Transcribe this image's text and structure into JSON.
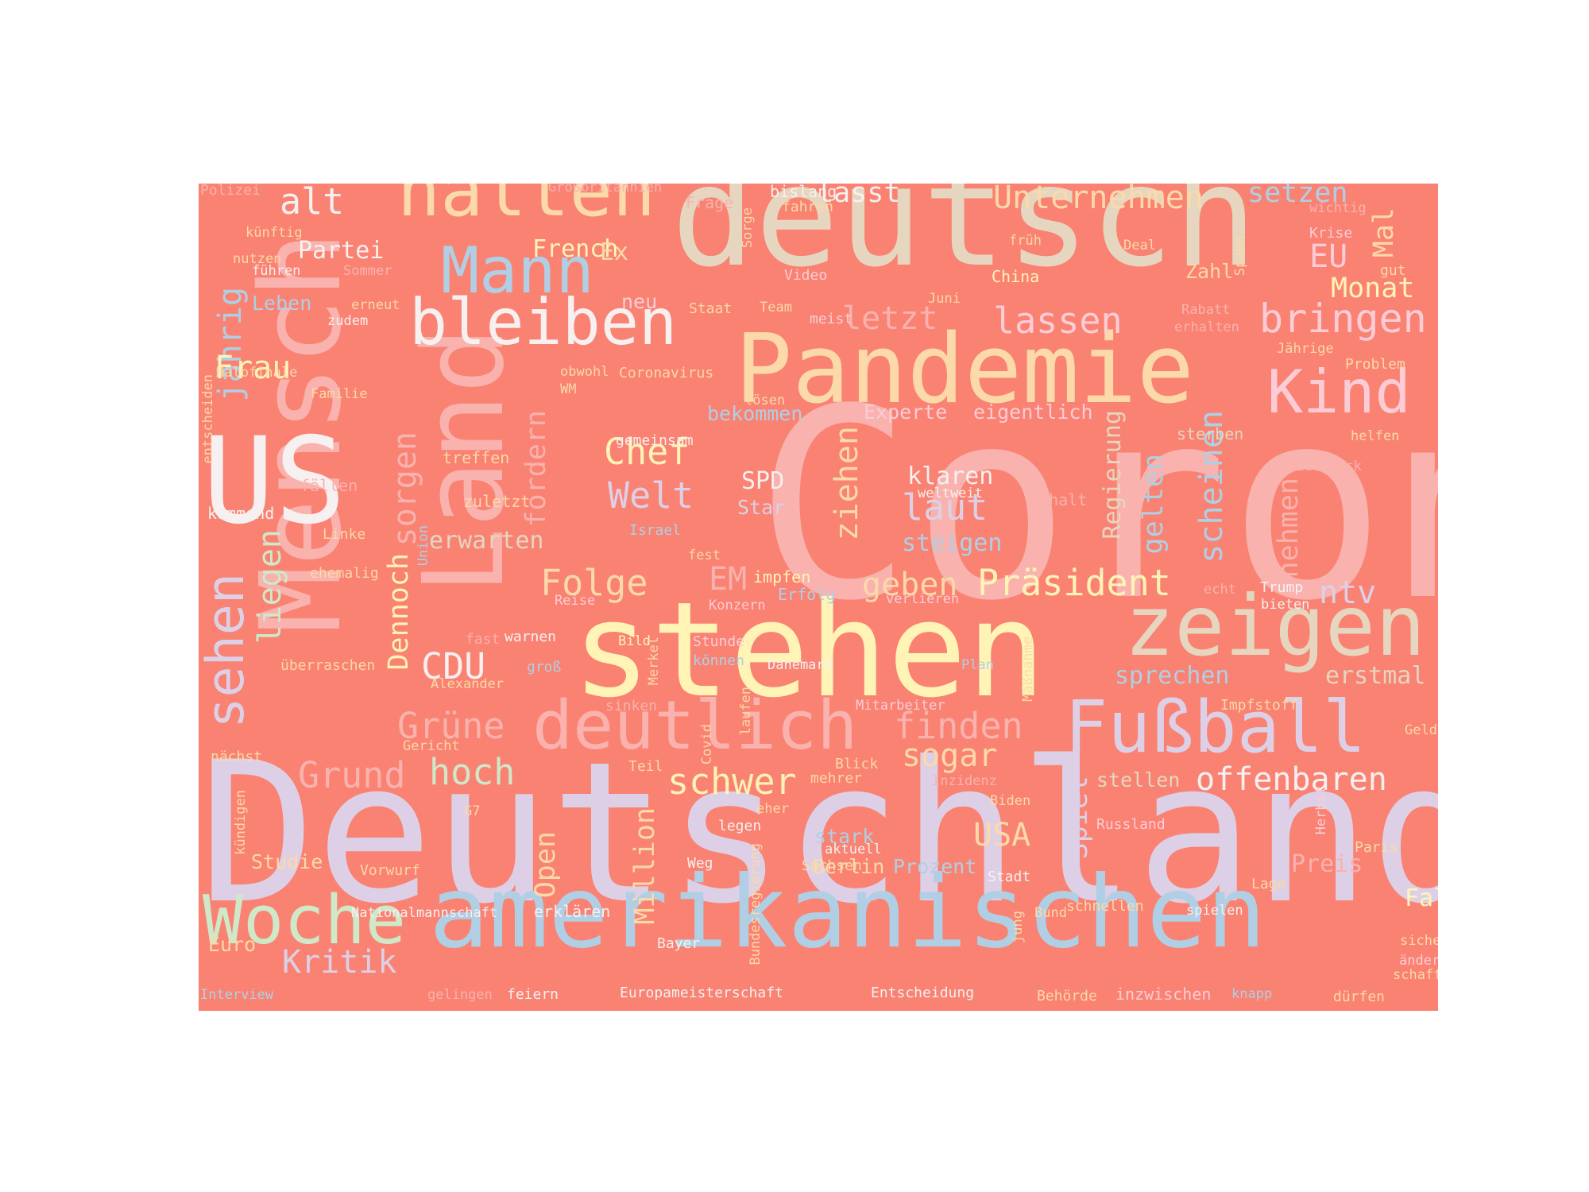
{
  "canvas": {
    "background": "#f98272"
  },
  "palette": {
    "lavender": "#ddd0e6",
    "pink": "#f9b2ae",
    "sand": "#e6d6c0",
    "yellow": "#fff4b6",
    "blue": "#b0cfe4",
    "peach": "#fcd9a8",
    "mint": "#cfe8c8",
    "white": "#f6f0f0",
    "rose": "#fcccd6"
  },
  "words": [
    {
      "text": "Corona",
      "color": "#f9b2ae"
    },
    {
      "text": "Deutschland",
      "color": "#ddd0e6"
    },
    {
      "text": "deutsch",
      "color": "#e6d6c0"
    },
    {
      "text": "stehen",
      "color": "#fff4b6"
    },
    {
      "text": "amerikanischen",
      "color": "#b0cfe4"
    },
    {
      "text": "Mensch",
      "color": "#f9b2ae"
    },
    {
      "text": "Land",
      "color": "#f9b2ae"
    },
    {
      "text": "Pandemie",
      "color": "#fcd9a8"
    },
    {
      "text": "US",
      "color": "#f6f0f0"
    },
    {
      "text": "zeigen",
      "color": "#e6d6c0"
    },
    {
      "text": "Fußball",
      "color": "#ddd0e6"
    },
    {
      "text": "deutlich",
      "color": "#f9b2ae"
    },
    {
      "text": "halten",
      "color": "#fcd9a8"
    },
    {
      "text": "bleiben",
      "color": "#f6f0f0"
    },
    {
      "text": "Mann",
      "color": "#b0cfe4"
    },
    {
      "text": "Woche",
      "color": "#cfe8c8"
    },
    {
      "text": "Kind",
      "color": "#fcccd6"
    },
    {
      "text": "sehen",
      "color": "#ddd0e6"
    },
    {
      "text": "bringen",
      "color": "#fcccd6"
    },
    {
      "text": "lassen",
      "color": "#fcccd6"
    },
    {
      "text": "Unternehmen",
      "color": "#fcd9a8"
    },
    {
      "text": "Präsident",
      "color": "#fff4b6"
    },
    {
      "text": "Folge",
      "color": "#fcd9a8"
    },
    {
      "text": "Grüne",
      "color": "#f9b2ae"
    },
    {
      "text": "finden",
      "color": "#f9b2ae"
    },
    {
      "text": "Welt",
      "color": "#ddd0e6"
    },
    {
      "text": "Chef",
      "color": "#fff4b6"
    },
    {
      "text": "CDU",
      "color": "#f6f0f0"
    },
    {
      "text": "Grund",
      "color": "#f9b2ae"
    },
    {
      "text": "hoch",
      "color": "#cfe8c8"
    },
    {
      "text": "schwer",
      "color": "#fff4b6"
    },
    {
      "text": "offenbaren",
      "color": "#f6f0f0"
    },
    {
      "text": "laut",
      "color": "#ddd0e6"
    },
    {
      "text": "Kritik",
      "color": "#ddd0e6"
    },
    {
      "text": "jährig",
      "color": "#b0cfe4"
    },
    {
      "text": "liegen",
      "color": "#cfe8c8"
    },
    {
      "text": "Dennoch",
      "color": "#fff4b6"
    },
    {
      "text": "sorgen",
      "color": "#f9b2ae"
    },
    {
      "text": "fordern",
      "color": "#f9b2ae"
    },
    {
      "text": "ziehen",
      "color": "#fcd9a8"
    },
    {
      "text": "gelten",
      "color": "#b0cfe4"
    },
    {
      "text": "scheinen",
      "color": "#b0cfe4"
    },
    {
      "text": "nehmen",
      "color": "#f9b2ae"
    },
    {
      "text": "ntv",
      "color": "#ddd0e6"
    },
    {
      "text": "geben",
      "color": "#fcd9a8"
    },
    {
      "text": "sogar",
      "color": "#fcd9a8"
    },
    {
      "text": "setzen",
      "color": "#b0cfe4"
    },
    {
      "text": "lässt",
      "color": "#f6f0f0"
    },
    {
      "text": "alt",
      "color": "#f6f0f0"
    },
    {
      "text": "Frau",
      "color": "#fff4b6"
    },
    {
      "text": "letzt",
      "color": "#f9b2ae"
    },
    {
      "text": "EU",
      "color": "#fcccd6"
    },
    {
      "text": "Mal",
      "color": "#fcd9a8"
    },
    {
      "text": "Monat",
      "color": "#fff4b6"
    },
    {
      "text": "Spiel",
      "color": "#ddd0e6"
    },
    {
      "text": "USA",
      "color": "#fcd9a8"
    },
    {
      "text": "Million",
      "color": "#fcd9a8"
    },
    {
      "text": "Open",
      "color": "#fcd9a8"
    },
    {
      "text": "EM",
      "color": "#f9b2ae"
    },
    {
      "text": "sprechen",
      "color": "#b0cfe4"
    },
    {
      "text": "erstmal",
      "color": "#e6d6c0"
    },
    {
      "text": "Regierung",
      "color": "#e6d6c0"
    },
    {
      "text": "erwarten",
      "color": "#e6d6c0"
    },
    {
      "text": "klaren",
      "color": "#f6f0f0"
    },
    {
      "text": "steigen",
      "color": "#b0cfe4"
    },
    {
      "text": "SPD",
      "color": "#f6f0f0"
    },
    {
      "text": "Star",
      "color": "#ddd0e6"
    },
    {
      "text": "Partei",
      "color": "#f6f0f0"
    },
    {
      "text": "French",
      "color": "#fff4b6"
    },
    {
      "text": "Ex",
      "color": "#fcd9a8"
    },
    {
      "text": "bekommen",
      "color": "#b0cfe4"
    },
    {
      "text": "Experte",
      "color": "#fcccd6"
    },
    {
      "text": "eigentlich",
      "color": "#fcccd6"
    },
    {
      "text": "stellen",
      "color": "#e6d6c0"
    },
    {
      "text": "stark",
      "color": "#b0cfe4"
    },
    {
      "text": "Euro",
      "color": "#fcd9a8"
    },
    {
      "text": "Fall",
      "color": "#fff4b6"
    },
    {
      "text": "Preis",
      "color": "#f9b2ae"
    },
    {
      "text": "Prozent",
      "color": "#b0cfe4"
    },
    {
      "text": "Berlin",
      "color": "#fcd9a8"
    },
    {
      "text": "Studie",
      "color": "#fcd9a8"
    },
    {
      "text": "Leben",
      "color": "#b0cfe4"
    },
    {
      "text": "Zahl",
      "color": "#fcd9a8"
    },
    {
      "text": "neu",
      "color": "#fcccd6"
    },
    {
      "text": "Großbritannien",
      "color": "#f9b2ae"
    },
    {
      "text": "Frage",
      "color": "#f9b2ae"
    },
    {
      "text": "bislang",
      "color": "#f6f0f0"
    },
    {
      "text": "fahren",
      "color": "#fcd9a8"
    },
    {
      "text": "wichtig",
      "color": "#f9b2ae"
    },
    {
      "text": "Polizei",
      "color": "#f9b2ae"
    },
    {
      "text": "künftig",
      "color": "#fcd9a8"
    },
    {
      "text": "nutzen",
      "color": "#fcd9a8"
    },
    {
      "text": "führen",
      "color": "#f6f0f0"
    },
    {
      "text": "Sommer",
      "color": "#f9b2ae"
    },
    {
      "text": "Sorge",
      "color": "#fcd9a8"
    },
    {
      "text": "früh",
      "color": "#fcd9a8"
    },
    {
      "text": "Deal",
      "color": "#fcd9a8"
    },
    {
      "text": "Krise",
      "color": "#fcccd6"
    },
    {
      "text": "Spahn",
      "color": "#fcd9a8"
    },
    {
      "text": "gut",
      "color": "#fcd9a8"
    },
    {
      "text": "Video",
      "color": "#fcccd6"
    },
    {
      "text": "China",
      "color": "#fff4b6"
    },
    {
      "text": "Juni",
      "color": "#fcd9a8"
    },
    {
      "text": "Staat",
      "color": "#fcd9a8"
    },
    {
      "text": "Team",
      "color": "#fcd9a8"
    },
    {
      "text": "meist",
      "color": "#fcccd6"
    },
    {
      "text": "Rabatt",
      "color": "#f9b2ae"
    },
    {
      "text": "erhalten",
      "color": "#f9b2ae"
    },
    {
      "text": "erneut",
      "color": "#fcd9a8"
    },
    {
      "text": "zudem",
      "color": "#f6f0f0"
    },
    {
      "text": "Jährige",
      "color": "#fcd9a8"
    },
    {
      "text": "Problem",
      "color": "#fcd9a8"
    },
    {
      "text": "Halbfinale",
      "color": "#fcd9a8"
    },
    {
      "text": "Familie",
      "color": "#fcd9a8"
    },
    {
      "text": "obwohl",
      "color": "#fcd9a8"
    },
    {
      "text": "WM",
      "color": "#fcd9a8"
    },
    {
      "text": "Coronavirus",
      "color": "#fcd9a8"
    },
    {
      "text": "lösen",
      "color": "#fcd9a8"
    },
    {
      "text": "sterben",
      "color": "#e6d6c0"
    },
    {
      "text": "helfen",
      "color": "#fcd9a8"
    },
    {
      "text": "entscheiden",
      "color": "#fcd9a8"
    },
    {
      "text": "gemeinsam",
      "color": "#f6f0f0"
    },
    {
      "text": "treffen",
      "color": "#fcd9a8"
    },
    {
      "text": "fällen",
      "color": "#f9b2ae"
    },
    {
      "text": "zuletzt",
      "color": "#fcd9a8"
    },
    {
      "text": "weltweit",
      "color": "#f6f0f0"
    },
    {
      "text": "Anhalt",
      "color": "#f9b2ae"
    },
    {
      "text": "Baerbock",
      "color": "#f9b2ae"
    },
    {
      "text": "kommend",
      "color": "#f6f0f0"
    },
    {
      "text": "Linke",
      "color": "#fcd9a8"
    },
    {
      "text": "Israel",
      "color": "#b0cfe4"
    },
    {
      "text": "Union",
      "color": "#b0cfe4"
    },
    {
      "text": "fest",
      "color": "#fcd9a8"
    },
    {
      "text": "impfen",
      "color": "#fff4b6"
    },
    {
      "text": "ehemalig",
      "color": "#fcd9a8"
    },
    {
      "text": "Reise",
      "color": "#fcccd6"
    },
    {
      "text": "Erfolg",
      "color": "#b0cfe4"
    },
    {
      "text": "Konzern",
      "color": "#fcccd6"
    },
    {
      "text": "verlieren",
      "color": "#fcccd6"
    },
    {
      "text": "echt",
      "color": "#f9b2ae"
    },
    {
      "text": "Trump",
      "color": "#f6f0f0"
    },
    {
      "text": "bieten",
      "color": "#f6f0f0"
    },
    {
      "text": "fast",
      "color": "#f9b2ae"
    },
    {
      "text": "warnen",
      "color": "#f6f0f0"
    },
    {
      "text": "Bild",
      "color": "#fff4b6"
    },
    {
      "text": "Stunde",
      "color": "#fcccd6"
    },
    {
      "text": "können",
      "color": "#b0cfe4"
    },
    {
      "text": "Dänemark",
      "color": "#f6f0f0"
    },
    {
      "text": "Maßnahme",
      "color": "#fcd9a8"
    },
    {
      "text": "Plan",
      "color": "#b0cfe4"
    },
    {
      "text": "überraschen",
      "color": "#fcd9a8"
    },
    {
      "text": "Alexander",
      "color": "#fcd9a8"
    },
    {
      "text": "groß",
      "color": "#b0cfe4"
    },
    {
      "text": "Merkel",
      "color": "#fcd9a8"
    },
    {
      "text": "sinken",
      "color": "#f9b2ae"
    },
    {
      "text": "Covid",
      "color": "#fcd9a8"
    },
    {
      "text": "laufen",
      "color": "#fcd9a8"
    },
    {
      "text": "Mitarbeiter",
      "color": "#fcccd6"
    },
    {
      "text": "Impfstoff",
      "color": "#fcd9a8"
    },
    {
      "text": "Geld",
      "color": "#fcd9a8"
    },
    {
      "text": "Gericht",
      "color": "#fcd9a8"
    },
    {
      "text": "nächst",
      "color": "#fcd9a8"
    },
    {
      "text": "Teil",
      "color": "#fcd9a8"
    },
    {
      "text": "Blick",
      "color": "#fcd9a8"
    },
    {
      "text": "mehrer",
      "color": "#fcd9a8"
    },
    {
      "text": "Inzidenz",
      "color": "#f9b2ae"
    },
    {
      "text": "Biden",
      "color": "#fcd9a8"
    },
    {
      "text": "G7",
      "color": "#fcd9a8"
    },
    {
      "text": "eher",
      "color": "#fcd9a8"
    },
    {
      "text": "legen",
      "color": "#f6f0f0"
    },
    {
      "text": "Russland",
      "color": "#fcccd6"
    },
    {
      "text": "Herbst",
      "color": "#fcccd6"
    },
    {
      "text": "Paris",
      "color": "#fcd9a8"
    },
    {
      "text": "kündigen",
      "color": "#fcd9a8"
    },
    {
      "text": "Weg",
      "color": "#f6f0f0"
    },
    {
      "text": "aktuell",
      "color": "#f6f0f0"
    },
    {
      "text": "Sachsen",
      "color": "#fcd9a8"
    },
    {
      "text": "Stadt",
      "color": "#f6f0f0"
    },
    {
      "text": "Lage",
      "color": "#fcd9a8"
    },
    {
      "text": "Vorwurf",
      "color": "#fcd9a8"
    },
    {
      "text": "Bundesregierung",
      "color": "#fcd9a8"
    },
    {
      "text": "Nationalmannschaft",
      "color": "#f6f0f0"
    },
    {
      "text": "erklären",
      "color": "#f6f0f0"
    },
    {
      "text": "Bund",
      "color": "#fcd9a8"
    },
    {
      "text": "schnellen",
      "color": "#fcd9a8"
    },
    {
      "text": "spielen",
      "color": "#f6f0f0"
    },
    {
      "text": "Bayer",
      "color": "#f6f0f0"
    },
    {
      "text": "jung",
      "color": "#fcd9a8"
    },
    {
      "text": "sichern",
      "color": "#fcd9a8"
    },
    {
      "text": "ändern",
      "color": "#fcccd6"
    },
    {
      "text": "schaffen",
      "color": "#fcd9a8"
    },
    {
      "text": "Interview",
      "color": "#b0cfe4"
    },
    {
      "text": "gelingen",
      "color": "#f9b2ae"
    },
    {
      "text": "feiern",
      "color": "#f6f0f0"
    },
    {
      "text": "Europameisterschaft",
      "color": "#f6f0f0"
    },
    {
      "text": "Entscheidung",
      "color": "#f6f0f0"
    },
    {
      "text": "Behörde",
      "color": "#fcd9a8"
    },
    {
      "text": "inzwischen",
      "color": "#fcccd6"
    },
    {
      "text": "knapp",
      "color": "#b0cfe4"
    },
    {
      "text": "dürfen",
      "color": "#fcd9a8"
    }
  ]
}
